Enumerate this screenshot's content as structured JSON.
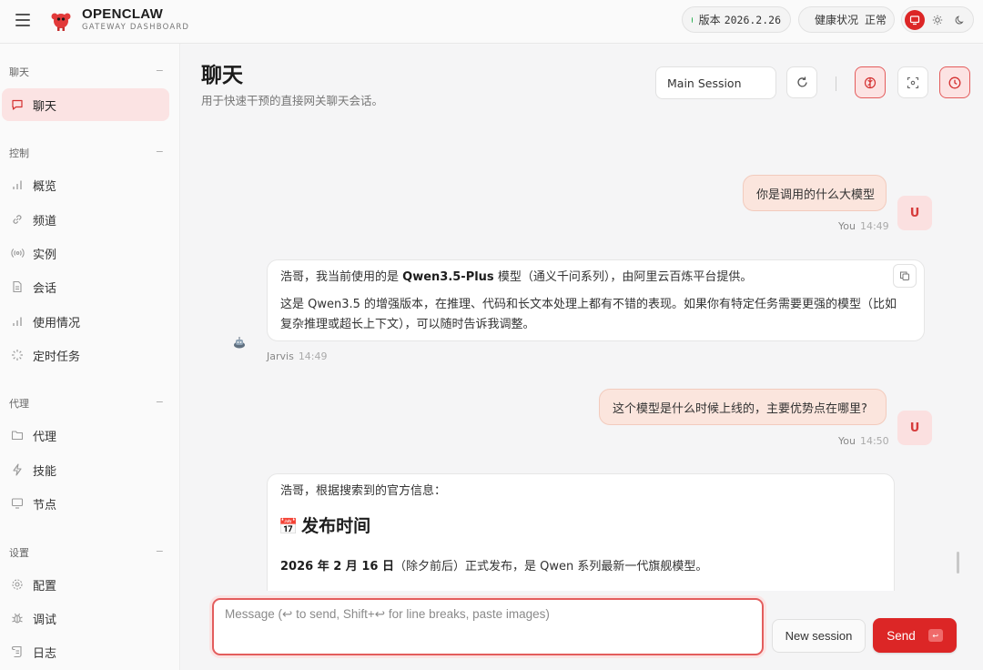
{
  "header": {
    "brand_title": "OPENCLAW",
    "brand_subtitle": "GATEWAY DASHBOARD",
    "version_label": "版本",
    "version_value": "2026.2.26",
    "health_label": "健康状况",
    "health_value": "正常"
  },
  "sidebar": {
    "sections": [
      {
        "title": "聊天",
        "collapse": "−",
        "items": [
          {
            "label": "聊天",
            "icon": "chat-icon",
            "active": true
          }
        ]
      },
      {
        "title": "控制",
        "collapse": "−",
        "items": [
          {
            "label": "概览",
            "icon": "bar-chart-icon"
          },
          {
            "label": "频道",
            "icon": "link-icon"
          },
          {
            "label": "实例",
            "icon": "broadcast-icon"
          },
          {
            "label": "会话",
            "icon": "document-icon"
          },
          {
            "label": "使用情况",
            "icon": "bar-chart-icon"
          },
          {
            "label": "定时任务",
            "icon": "loader-icon"
          }
        ]
      },
      {
        "title": "代理",
        "collapse": "−",
        "items": [
          {
            "label": "代理",
            "icon": "folder-icon"
          },
          {
            "label": "技能",
            "icon": "lightning-icon"
          },
          {
            "label": "节点",
            "icon": "monitor-icon"
          }
        ]
      },
      {
        "title": "设置",
        "collapse": "−",
        "items": [
          {
            "label": "配置",
            "icon": "gear-icon"
          },
          {
            "label": "调试",
            "icon": "bug-icon"
          },
          {
            "label": "日志",
            "icon": "scroll-icon"
          }
        ]
      }
    ]
  },
  "main": {
    "title": "聊天",
    "subtitle": "用于快速干预的直接网关聊天会话。",
    "session_select": "Main Session",
    "messages": [
      {
        "role": "user",
        "text": "你是调用的什么大模型",
        "sender": "You",
        "time": "14:49",
        "avatar": "U"
      },
      {
        "role": "assistant",
        "sender": "Jarvis",
        "time": "14:49",
        "p1_a": "浩哥，我当前使用的是 ",
        "p1_bold": "Qwen3.5-Plus",
        "p1_b": " 模型（通义千问系列），由阿里云百炼平台提供。",
        "p2_line1": "这是 Qwen3.5 的增强版本，在推理、代码和长文本处理上都有不错的表现。如果你有特定任务需要更强的模型（比如",
        "p2_line2": "复杂推理或超长上下文），可以随时告诉我调整。"
      },
      {
        "role": "user",
        "text": "这个模型是什么时候上线的，主要优势点在哪里?",
        "sender": "You",
        "time": "14:50",
        "avatar": "U"
      },
      {
        "role": "assistant",
        "intro": "浩哥，根据搜索到的官方信息：",
        "heading_emoji": "📅",
        "heading": "发布时间",
        "line_bold": "2026 年 2 月 16 日",
        "line_rest": "（除夕前后）正式发布，是 Qwen 系列最新一代旗舰模型。"
      }
    ]
  },
  "composer": {
    "placeholder": "Message (↩ to send, Shift+↩ for line breaks, paste images)",
    "new_session": "New session",
    "send": "Send",
    "send_kbd": "↩"
  },
  "colors": {
    "accent": "#dc2626",
    "accent_soft": "#fbe3e3",
    "status_ok": "#22b04b"
  }
}
